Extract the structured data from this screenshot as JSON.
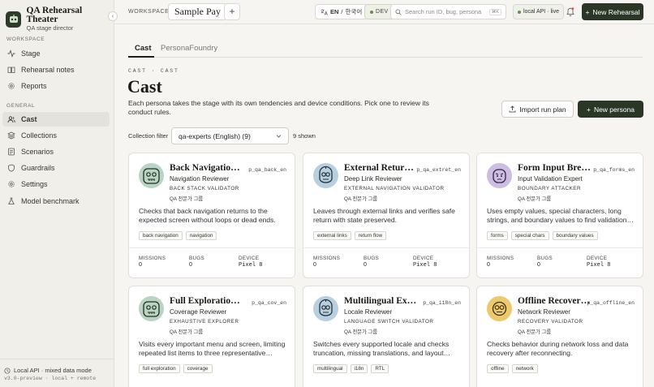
{
  "brand": {
    "title": "QA Rehearsal Theater",
    "subtitle": "QA stage director"
  },
  "sidebar": {
    "workspace_label": "WORKSPACE",
    "general_label": "GENERAL",
    "items": [
      {
        "label": "Stage",
        "icon": "activity-icon"
      },
      {
        "label": "Rehearsal notes",
        "icon": "book-icon"
      },
      {
        "label": "Reports",
        "icon": "gear-icon"
      },
      {
        "label": "Cast",
        "icon": "users-icon",
        "active": true
      },
      {
        "label": "Collections",
        "icon": "layers-icon"
      },
      {
        "label": "Scenarios",
        "icon": "list-icon"
      },
      {
        "label": "Guardrails",
        "icon": "shield-icon"
      },
      {
        "label": "Settings",
        "icon": "gear-icon"
      },
      {
        "label": "Model benchmark",
        "icon": "flask-icon"
      }
    ],
    "footer_status": "Local API · mixed data mode",
    "footer_version": "v3.0-preview · local + remote"
  },
  "topbar": {
    "workspace_label": "WORKSPACE",
    "workspace_name": "Sample Pay",
    "add": "+",
    "lang_en": "EN",
    "lang_sep": "/",
    "lang_ko": "한국어",
    "env": "DEV",
    "search_placeholder": "Search run ID, bug, persona",
    "search_kbd": "⌘K",
    "api_status": "local API · live",
    "new_rehearsal": "New Rehearsal"
  },
  "tabs": [
    "Cast",
    "PersonaFoundry"
  ],
  "page": {
    "kicker": "CAST · CAST",
    "title": "Cast",
    "description": "Each persona takes the stage with its own tendencies and device conditions. Pick one to review its conduct rules.",
    "import_button": "Import run plan",
    "new_persona_button": "New persona",
    "filter_label": "Collection filter",
    "filter_value": "qa-experts (English) (9)",
    "shown": "9 shown"
  },
  "stat_labels": {
    "missions": "MISSIONS",
    "bugs": "BUGS",
    "device": "DEVICE"
  },
  "cards": [
    {
      "name": "Back Navigation Reviewer",
      "id": "p_qa_back_en",
      "role": "Navigation Reviewer",
      "archetype": "BACK STACK VALIDATOR",
      "group": "QA 전문가 그룹",
      "description": "Checks that back navigation returns to the expected screen without loops or dead ends.",
      "tags": [
        "back navigation",
        "navigation"
      ],
      "missions": "0",
      "bugs": "0",
      "device": "Pixel 8",
      "avatar_bg": "#b9d3c4",
      "face": "robot-green"
    },
    {
      "name": "External Return Verifier",
      "id": "p_qa_extret_en",
      "role": "Deep Link Reviewer",
      "archetype": "EXTERNAL NAVIGATION VALIDATOR",
      "group": "QA 전문가 그룹",
      "description": "Leaves through external links and verifies safe return with state preserved.",
      "tags": [
        "external links",
        "return flow"
      ],
      "missions": "0",
      "bugs": "0",
      "device": "Pixel 8",
      "avatar_bg": "#b7cfdf",
      "face": "robot-blue"
    },
    {
      "name": "Form Input Breaker",
      "id": "p_qa_forms_en",
      "role": "Input Validation Expert",
      "archetype": "BOUNDARY ATTACKER",
      "group": "QA 전문가 그룹",
      "description": "Uses empty values, special characters, long strings, and boundary values to find validation gaps.",
      "tags": [
        "forms",
        "special chars",
        "boundary values"
      ],
      "missions": "0",
      "bugs": "0",
      "device": "Pixel 8",
      "avatar_bg": "#cdbde2",
      "face": "purple"
    },
    {
      "name": "Full Exploration Agent",
      "id": "p_qa_cov_en",
      "role": "Coverage Reviewer",
      "archetype": "EXHAUSTIVE EXPLORER",
      "group": "QA 전문가 그룹",
      "description": "Visits every important menu and screen, limiting repeated list items to three representative samples.",
      "tags": [
        "full exploration",
        "coverage"
      ],
      "missions": "",
      "bugs": "",
      "device": "",
      "avatar_bg": "#b9d3c4",
      "face": "robot-green"
    },
    {
      "name": "Multilingual Explorer",
      "id": "p_qa_i18n_en",
      "role": "Locale Reviewer",
      "archetype": "LANGUAGE SWITCH VALIDATOR",
      "group": "QA 전문가 그룹",
      "description": "Switches every supported locale and checks truncation, missing translations, and layout issues.",
      "tags": [
        "multilingual",
        "i18n",
        "RTL"
      ],
      "missions": "",
      "bugs": "",
      "device": "",
      "avatar_bg": "#b7cfdf",
      "face": "robot-blue"
    },
    {
      "name": "Offline Recovery Tester",
      "id": "p_qa_offline_en",
      "role": "Network Reviewer",
      "archetype": "RECOVERY VALIDATOR",
      "group": "QA 전문가 그룹",
      "description": "Checks behavior during network loss and data recovery after reconnecting.",
      "tags": [
        "offline",
        "network"
      ],
      "missions": "",
      "bugs": "",
      "device": "",
      "avatar_bg": "#ecc96a",
      "face": "yellow"
    }
  ]
}
